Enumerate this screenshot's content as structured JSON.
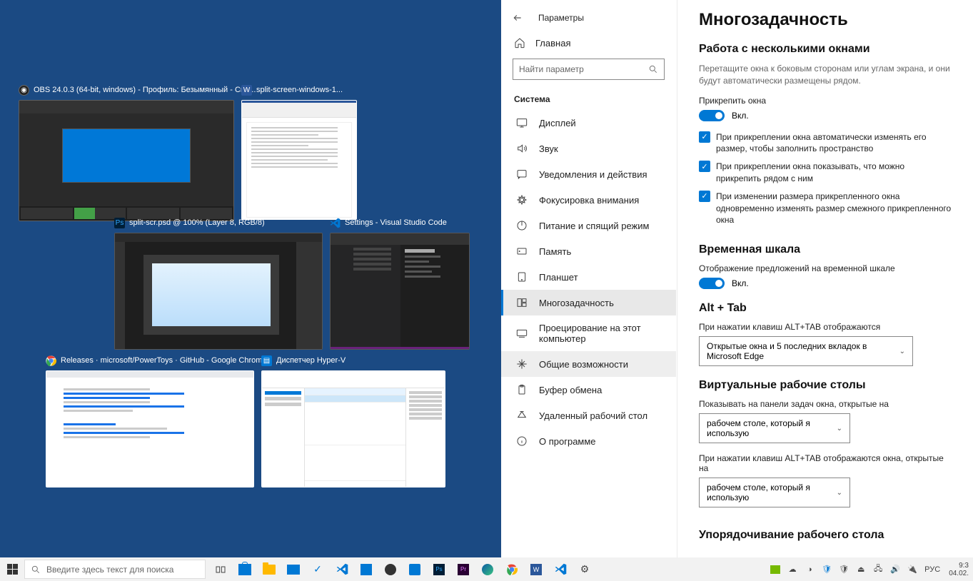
{
  "taskview": {
    "obs": {
      "title": "OBS 24.0.3 (64-bit, windows) - Профиль: Безымянный - Сце..."
    },
    "word": {
      "title": "split-screen-windows-1..."
    },
    "ps": {
      "title": "split-scr.psd @ 100% (Layer 8, RGB/8)"
    },
    "vscode": {
      "title": "Settings - Visual Studio Code",
      "heading": "Commonly Used"
    },
    "chrome": {
      "title": "Releases · microsoft/PowerToys · GitHub - Google Chrome"
    },
    "hyperv": {
      "title": "Диспетчер Hyper-V"
    }
  },
  "settings": {
    "header_title": "Параметры",
    "home_label": "Главная",
    "search_placeholder": "Найти параметр",
    "section_label": "Система",
    "nav": {
      "display": "Дисплей",
      "sound": "Звук",
      "notifications": "Уведомления и действия",
      "focus": "Фокусировка внимания",
      "power": "Питание и спящий режим",
      "storage": "Память",
      "tablet": "Планшет",
      "multitasking": "Многозадачность",
      "projecting": "Проецирование на этот компьютер",
      "shared": "Общие возможности",
      "clipboard": "Буфер обмена",
      "remote": "Удаленный рабочий стол",
      "about": "О программе"
    },
    "page": {
      "title": "Многозадачность",
      "snap_heading": "Работа с несколькими окнами",
      "snap_desc": "Перетащите окна к боковым сторонам или углам экрана, и они будут автоматически размещены рядом.",
      "snap_label": "Прикрепить окна",
      "toggle_on": "Вкл.",
      "chk1": "При прикреплении окна автоматически изменять его размер, чтобы заполнить пространство",
      "chk2": "При прикреплении окна показывать, что можно прикрепить рядом с ним",
      "chk3": "При изменении размера прикрепленного окна одновременно изменять размер смежного прикрепленного окна",
      "timeline_heading": "Временная шкала",
      "timeline_label": "Отображение предложений на временной шкале",
      "alttab_heading": "Alt + Tab",
      "alttab_label": "При нажатии клавиш ALT+TAB отображаются",
      "alttab_option": "Открытые окна и 5 последних вкладок в Microsoft Edge",
      "vd_heading": "Виртуальные рабочие столы",
      "vd_label1": "Показывать на панели задач окна, открытые на",
      "vd_option1": "рабочем столе, который я использую",
      "vd_label2": "При нажатии клавиш ALT+TAB отображаются окна, открытые на",
      "vd_option2": "рабочем столе, который я использую",
      "tidy_heading": "Упорядочивание рабочего стола"
    }
  },
  "taskbar": {
    "search_placeholder": "Введите здесь текст для поиска",
    "lang": "РУС",
    "time": "9:3",
    "date": "04.02."
  }
}
